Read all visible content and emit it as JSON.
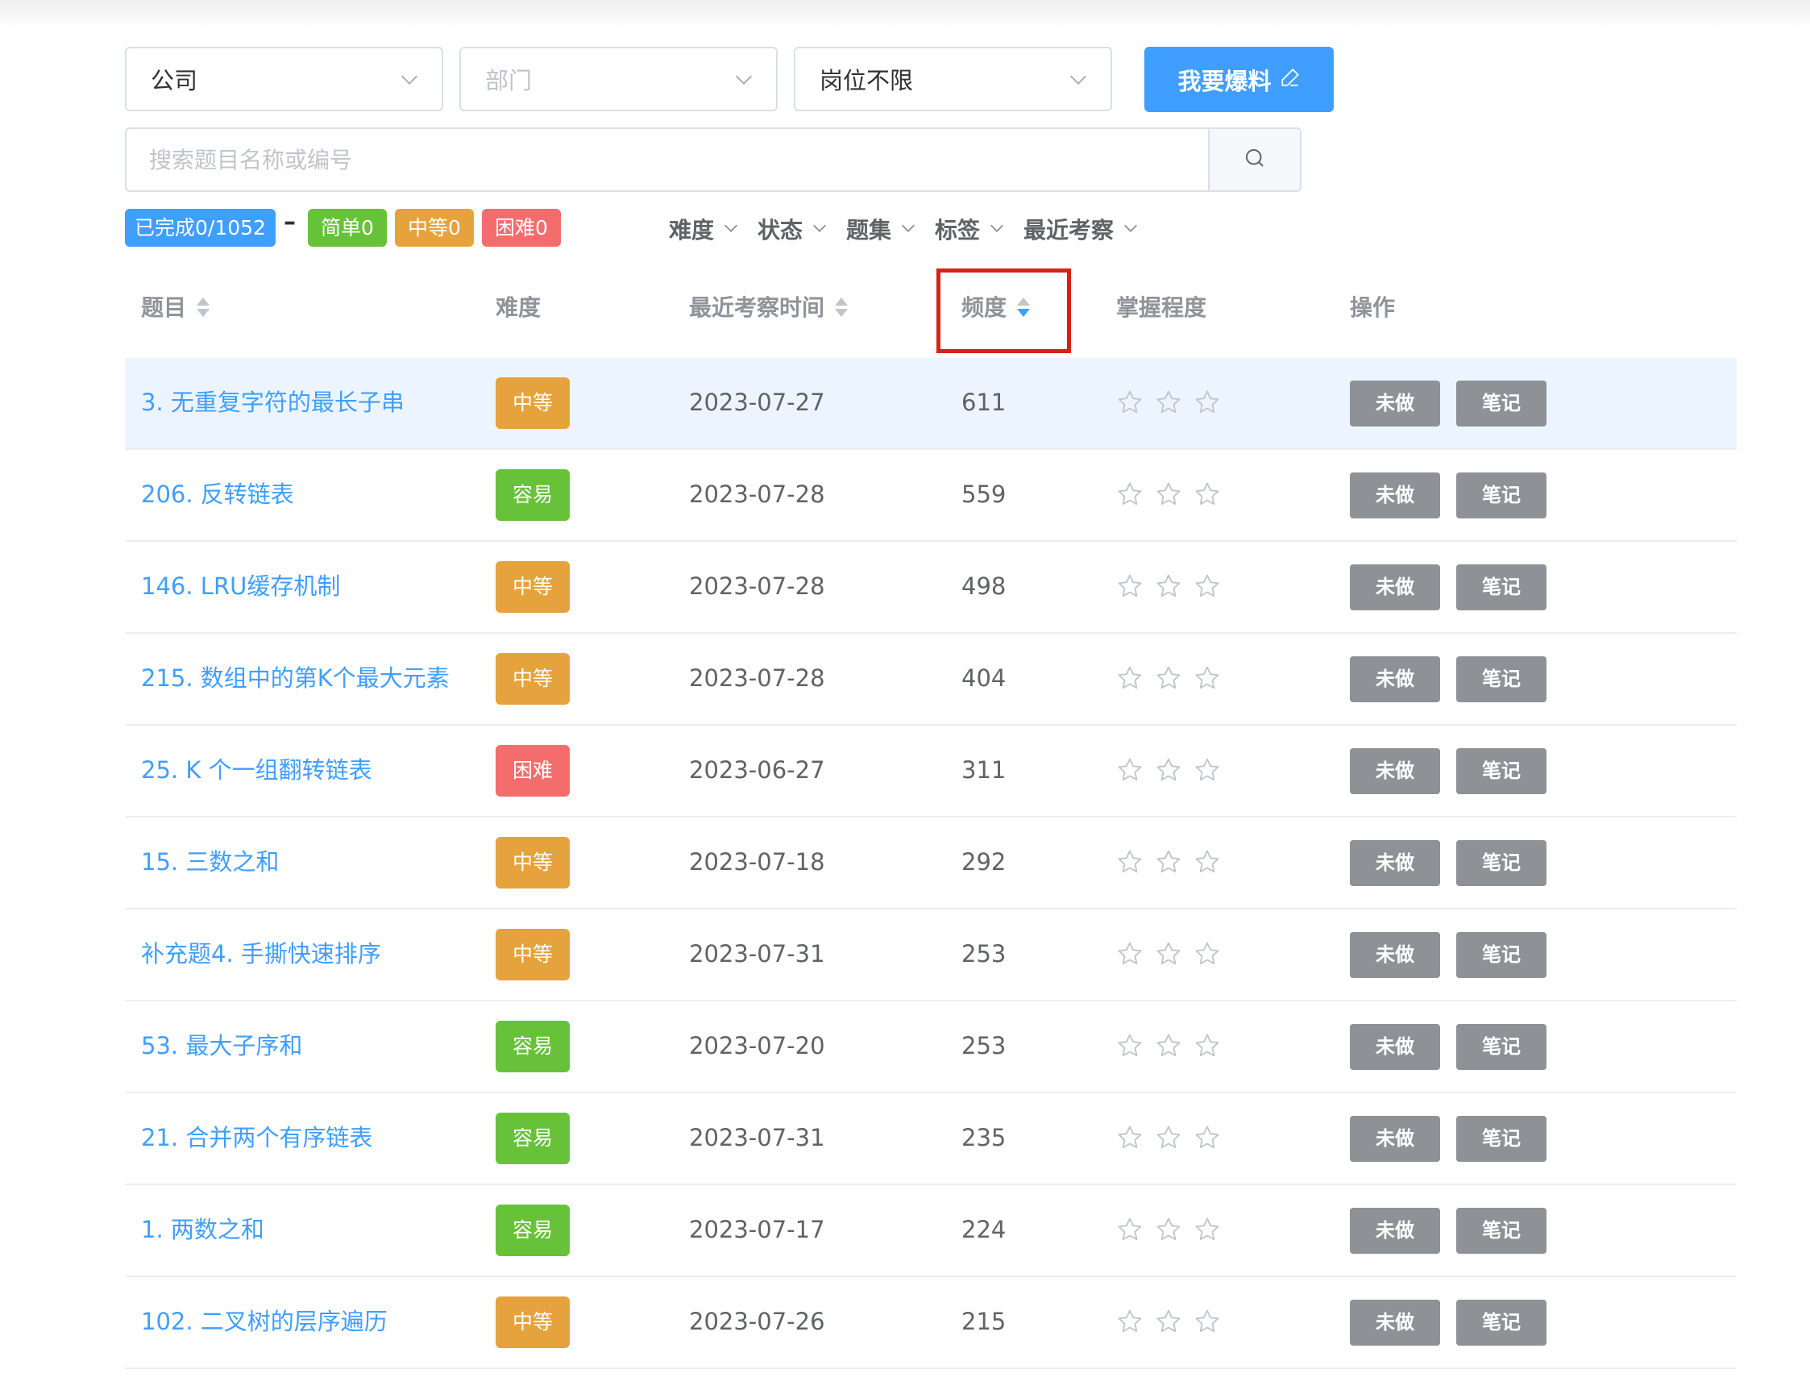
{
  "filters": {
    "company": {
      "value": "公司",
      "placeholder": false
    },
    "department": {
      "value": "部门",
      "placeholder": true
    },
    "position": {
      "value": "岗位不限",
      "placeholder": false
    },
    "submit_label": "我要爆料"
  },
  "search": {
    "placeholder": "搜索题目名称或编号"
  },
  "stats": {
    "completed": "已完成0/1052",
    "separator": "–",
    "easy": "简单0",
    "medium": "中等0",
    "hard": "困难0"
  },
  "dropdowns": [
    "难度",
    "状态",
    "题集",
    "标签",
    "最近考察"
  ],
  "table": {
    "headers": {
      "title": "题目",
      "difficulty": "难度",
      "recent": "最近考察时间",
      "frequency": "频度",
      "mastery": "掌握程度",
      "actions": "操作"
    },
    "action_labels": {
      "status": "未做",
      "notes": "笔记"
    },
    "rows": [
      {
        "title": "3. 无重复字符的最长子串",
        "difficulty": "中等",
        "date": "2023-07-27",
        "freq": "611"
      },
      {
        "title": "206. 反转链表",
        "difficulty": "容易",
        "date": "2023-07-28",
        "freq": "559"
      },
      {
        "title": "146. LRU缓存机制",
        "difficulty": "中等",
        "date": "2023-07-28",
        "freq": "498"
      },
      {
        "title": "215. 数组中的第K个最大元素",
        "difficulty": "中等",
        "date": "2023-07-28",
        "freq": "404"
      },
      {
        "title": "25. K 个一组翻转链表",
        "difficulty": "困难",
        "date": "2023-06-27",
        "freq": "311"
      },
      {
        "title": "15. 三数之和",
        "difficulty": "中等",
        "date": "2023-07-18",
        "freq": "292"
      },
      {
        "title": "补充题4. 手撕快速排序",
        "difficulty": "中等",
        "date": "2023-07-31",
        "freq": "253"
      },
      {
        "title": "53. 最大子序和",
        "difficulty": "容易",
        "date": "2023-07-20",
        "freq": "253"
      },
      {
        "title": "21. 合并两个有序链表",
        "difficulty": "容易",
        "date": "2023-07-31",
        "freq": "235"
      },
      {
        "title": "1. 两数之和",
        "difficulty": "容易",
        "date": "2023-07-17",
        "freq": "224"
      },
      {
        "title": "102. 二叉树的层序遍历",
        "difficulty": "中等",
        "date": "2023-07-26",
        "freq": "215"
      }
    ]
  },
  "colors": {
    "primary": "#409eff",
    "easy": "#67c23a",
    "medium": "#e6a23c",
    "hard": "#f56c6c",
    "action_button": "#8e9196",
    "highlight": "#d9201b"
  }
}
